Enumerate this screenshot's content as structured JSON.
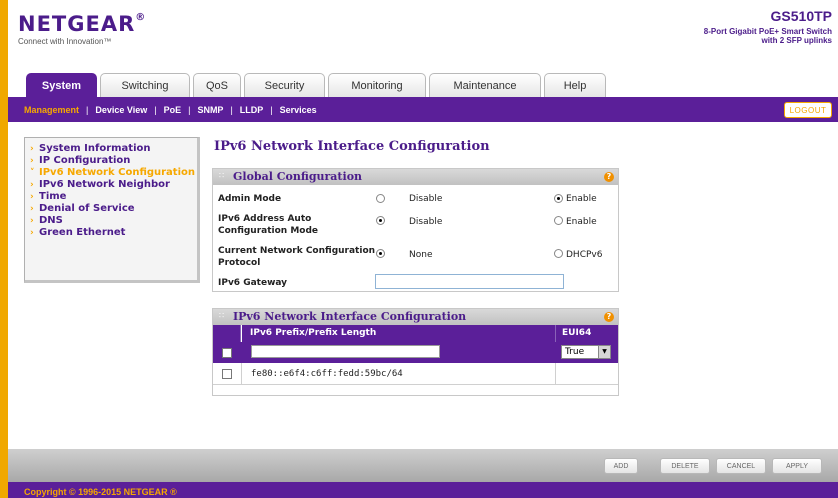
{
  "header": {
    "brand": "NETGEAR",
    "brand_mark": "®",
    "tagline": "Connect with Innovation™",
    "model": "GS510TP",
    "model_desc_line1": "8-Port Gigabit PoE+ Smart Switch",
    "model_desc_line2": "with 2 SFP uplinks"
  },
  "tabs": [
    "System",
    "Switching",
    "QoS",
    "Security",
    "Monitoring",
    "Maintenance",
    "Help"
  ],
  "subnav": {
    "items": [
      "Management",
      "Device View",
      "PoE",
      "SNMP",
      "LLDP",
      "Services"
    ],
    "separator": "|",
    "logout": "LOGOUT"
  },
  "sidebar": {
    "items": [
      "System Information",
      "IP Configuration",
      "IPv6 Network Configuration",
      "IPv6 Network Neighbor",
      "Time",
      "Denial of Service",
      "DNS",
      "Green Ethernet"
    ],
    "active_index": 2
  },
  "page_title": "IPv6 Network Interface Configuration",
  "global_config": {
    "title": "Global Configuration",
    "help": "?",
    "admin_mode": {
      "label": "Admin Mode",
      "opt1": "Disable",
      "opt2": "Enable",
      "selected": "Enable"
    },
    "auto_config": {
      "label_line1": "IPv6 Address Auto",
      "label_line2": "Configuration Mode",
      "opt1": "Disable",
      "opt2": "Enable",
      "selected": "Disable"
    },
    "protocol": {
      "label_line1": "Current Network Configuration",
      "label_line2": "Protocol",
      "opt1": "None",
      "opt2": "DHCPv6",
      "selected": "None"
    },
    "gateway": {
      "label": "IPv6 Gateway",
      "value": ""
    }
  },
  "interface_table": {
    "title": "IPv6 Network Interface Configuration",
    "help": "?",
    "col_prefix": "IPv6 Prefix/Prefix Length",
    "col_eui": "EUI64",
    "new_row": {
      "prefix": "",
      "eui": "True"
    },
    "rows": [
      {
        "prefix": "fe80::e6f4:c6ff:fedd:59bc/64",
        "eui": ""
      }
    ]
  },
  "actions": {
    "add": "ADD",
    "delete": "DELETE",
    "cancel": "CANCEL",
    "apply": "APPLY"
  },
  "footer": {
    "copyright": "Copyright © 1996-2015 NETGEAR ®"
  },
  "colors": {
    "purple": "#5b1f99",
    "orange": "#f6a800"
  }
}
